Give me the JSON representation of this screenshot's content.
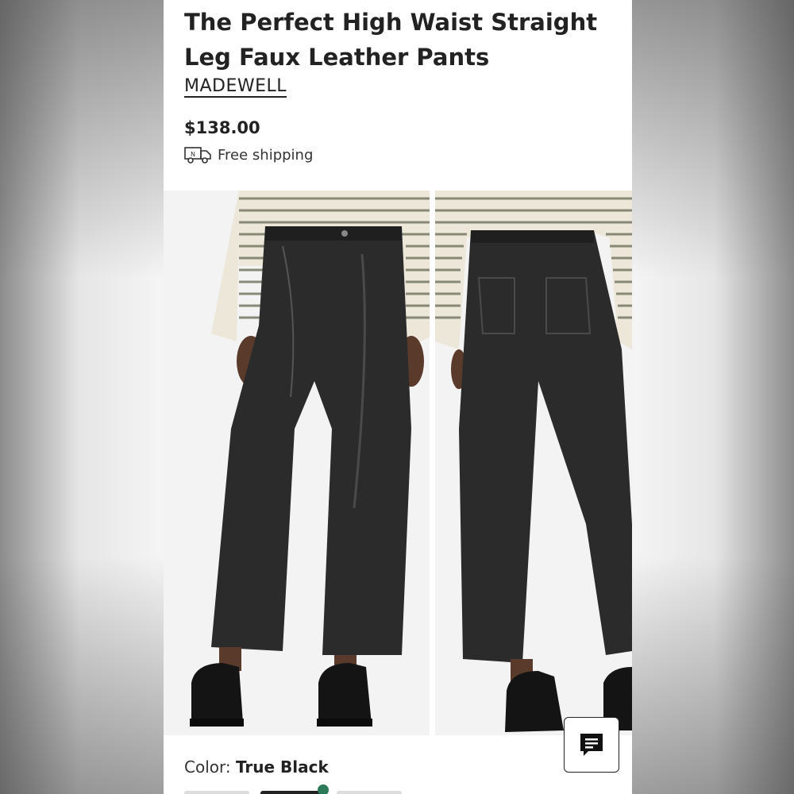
{
  "product": {
    "title": "The Perfect High Waist Straight Leg Faux Leather Pants",
    "brand": "MADEWELL",
    "price": "$138.00",
    "shipping_label": "Free shipping",
    "shipping_icon": "truck-icon",
    "color_label": "Color:",
    "color_value": "True Black"
  },
  "images": [
    {
      "name": "front-view",
      "alt": ""
    },
    {
      "name": "back-view",
      "alt": ""
    }
  ],
  "chat": {
    "icon": "chat-icon"
  },
  "colors": {
    "sweater": "#ece7d8",
    "stripe": "#7d7f6b",
    "pants": "#2b2b2b",
    "skin": "#5a3a2a"
  }
}
